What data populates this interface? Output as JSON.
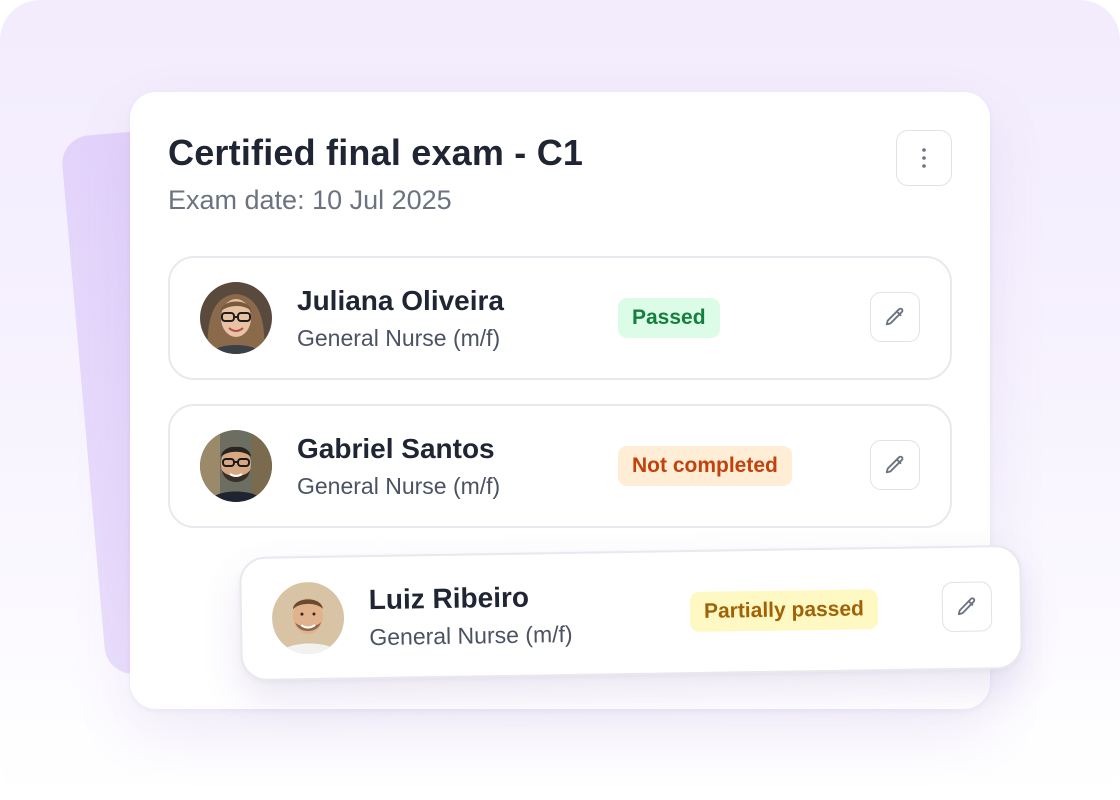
{
  "exam": {
    "title": "Certified final exam - C1",
    "subtitle": "Exam date: 10 Jul 2025",
    "menu_icon": "more-vertical-icon"
  },
  "candidates": [
    {
      "name": "Juliana Oliveira",
      "role": "General Nurse (m/f)",
      "status": "Passed",
      "status_color": "#15803d",
      "status_bg": "#dcfce7",
      "edit_icon": "pencil-icon"
    },
    {
      "name": "Gabriel Santos",
      "role": "General Nurse (m/f)",
      "status": "Not completed",
      "status_color": "#c2410c",
      "status_bg": "#ffedd5",
      "edit_icon": "pencil-icon"
    },
    {
      "name": "Luiz Ribeiro",
      "role": "General Nurse (m/f)",
      "status": "Partially passed",
      "status_color": "#a16207",
      "status_bg": "#fef9c3",
      "edit_icon": "pencil-icon"
    }
  ],
  "colors": {
    "accent_lavender": "#e3d3fb",
    "text_primary": "#1f2533",
    "text_secondary": "#6b7280"
  }
}
